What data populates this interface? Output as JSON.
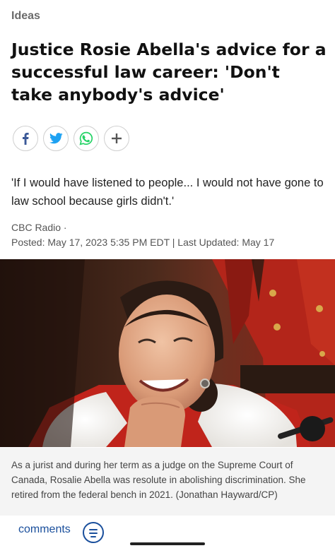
{
  "article": {
    "section": "Ideas",
    "headline": "Justice Rosie Abella's advice for a successful law career: 'Don't take anybody's advice'",
    "dek": "'If I would have listened to people... I would not have gone to law school because girls didn't.'",
    "source": "CBC Radio ·",
    "dateline": "Posted: May 17, 2023 5:35 PM EDT | Last Updated: May 17",
    "caption": "As a jurist and during her term as a judge on the Supreme Court of Canada, Rosalie Abella was resolute in abolishing discrimination. She retired from the federal bench in 2021. (Jonathan Hayward/CP)"
  },
  "share": {
    "buttons": [
      {
        "icon": "facebook-icon",
        "color": "#3b5998"
      },
      {
        "icon": "twitter-icon",
        "color": "#1da1f2"
      },
      {
        "icon": "whatsapp-icon",
        "color": "#25d366"
      },
      {
        "icon": "plus-icon",
        "color": "#555555"
      }
    ]
  },
  "footer": {
    "comments_label": "comments",
    "comments_icon": "comment-list-icon",
    "accent": "#1a4f9c"
  }
}
